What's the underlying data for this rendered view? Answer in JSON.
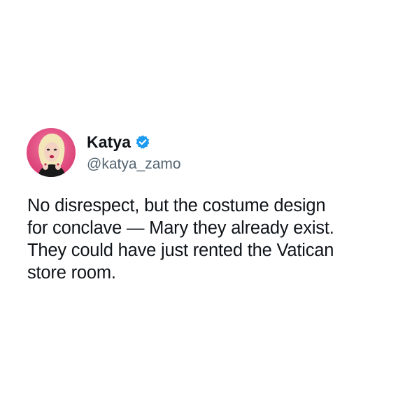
{
  "tweet": {
    "author": {
      "display_name": "Katya",
      "handle": "@katya_zamo",
      "verified": true,
      "avatar_icon": "profile-avatar",
      "verified_icon": "verified-badge-icon",
      "colors": {
        "verified_badge": "#1d9bf0",
        "avatar_background": "#e0457a",
        "handle_text": "#536471"
      }
    },
    "text_lines": [
      "No disrespect, but the costume design",
      "for conclave — Mary they already exist.",
      "They could have just rented the Vatican",
      "store room."
    ]
  }
}
